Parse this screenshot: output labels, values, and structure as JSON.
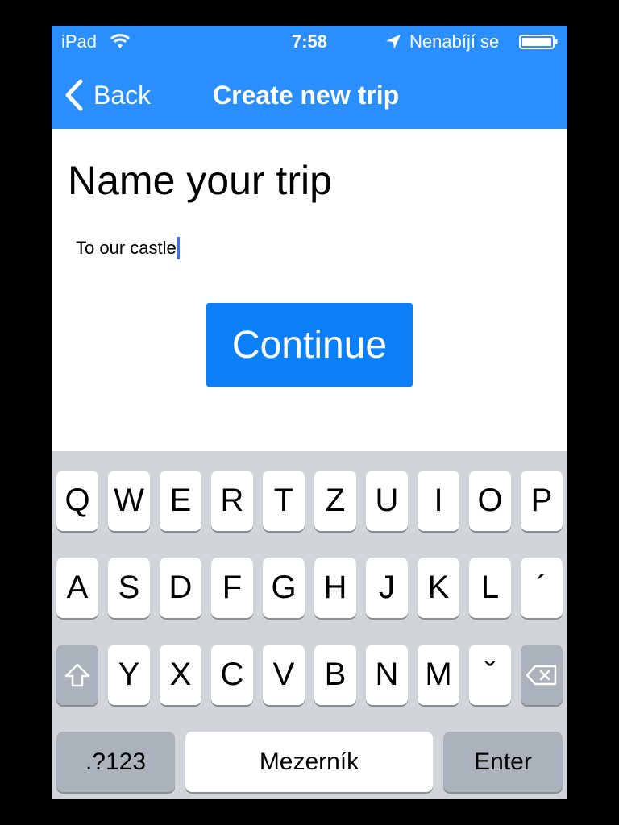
{
  "status_bar": {
    "device": "iPad",
    "time": "7:58",
    "carrier": "Nenabíjí se",
    "wifi_icon": "wifi-icon",
    "location_icon": "location-arrow-icon",
    "battery_icon": "battery-icon"
  },
  "nav": {
    "back_label": "Back",
    "back_icon": "chevron-left-icon",
    "title": "Create new trip"
  },
  "content": {
    "heading": "Name your trip",
    "trip_name_value": "To our castle",
    "continue_label": "Continue"
  },
  "keyboard": {
    "row1": [
      "Q",
      "W",
      "E",
      "R",
      "T",
      "Z",
      "U",
      "I",
      "O",
      "P"
    ],
    "row2": [
      "A",
      "S",
      "D",
      "F",
      "G",
      "H",
      "J",
      "K",
      "L",
      "´"
    ],
    "row3": [
      "Y",
      "X",
      "C",
      "V",
      "B",
      "N",
      "M",
      "ˇ"
    ],
    "shift_icon": "shift-arrow-icon",
    "backspace_icon": "backspace-icon",
    "numbers_label": ".?123",
    "space_label": "Mezerník",
    "enter_label": "Enter"
  },
  "colors": {
    "nav_bar": "#2a8ffc",
    "button": "#0a7ff7",
    "keyboard_bg": "#d1d4d9",
    "caret": "#3c6ff5"
  }
}
